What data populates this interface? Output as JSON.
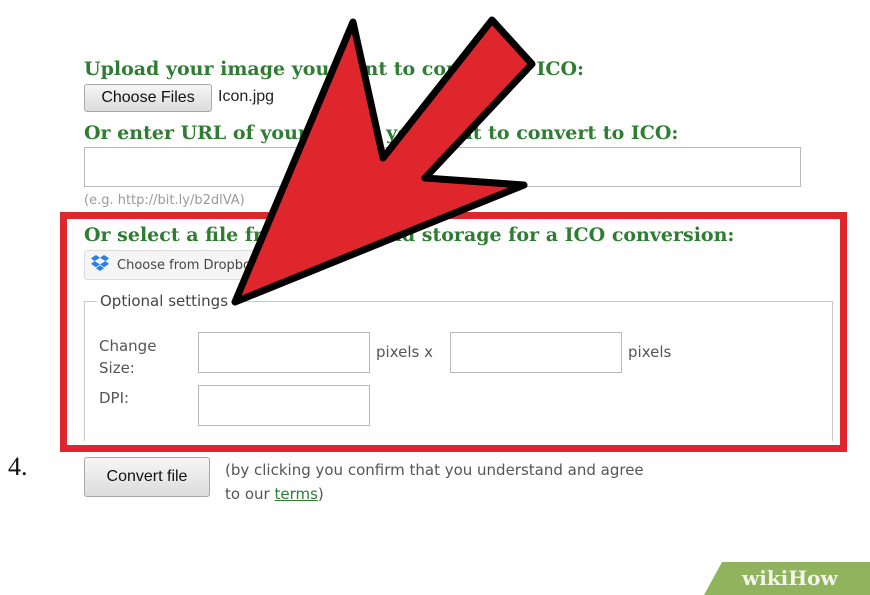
{
  "step_number": "4.",
  "upload": {
    "heading": "Upload your image you want to convert to ICO:",
    "choose_files_label": "Choose Files",
    "file_name": "Icon.jpg"
  },
  "url_section": {
    "heading": "Or enter URL of your image you want to convert to ICO:",
    "url_value": "",
    "example_hint": "(e.g. http://bit.ly/b2dlVA)"
  },
  "cloud_section": {
    "heading": "Or select a file from your cloud storage for a ICO conversion:",
    "dropbox_label": "Choose from Dropbox"
  },
  "optional_settings": {
    "legend": "Optional settings",
    "change_size_label_line1": "Change",
    "change_size_label_line2": "Size:",
    "width_value": "",
    "pixels_x_label": "pixels x",
    "height_value": "",
    "pixels_label": "pixels",
    "dpi_label": "DPI:",
    "dpi_value": ""
  },
  "convert": {
    "button_label": "Convert file",
    "confirm_text_line1": "(by clicking you confirm that you understand and agree",
    "confirm_text_prefix": "to our ",
    "terms_link": "terms",
    "confirm_text_suffix": ")"
  },
  "watermark": {
    "brand": "wikiHow"
  },
  "colors": {
    "heading_green": "#2e7d32",
    "highlight_red": "#e0262d",
    "arrow_red": "#e0262d",
    "watermark_green": "#8fb45d"
  },
  "icons": [
    "dropbox-icon",
    "annotation-arrow"
  ]
}
